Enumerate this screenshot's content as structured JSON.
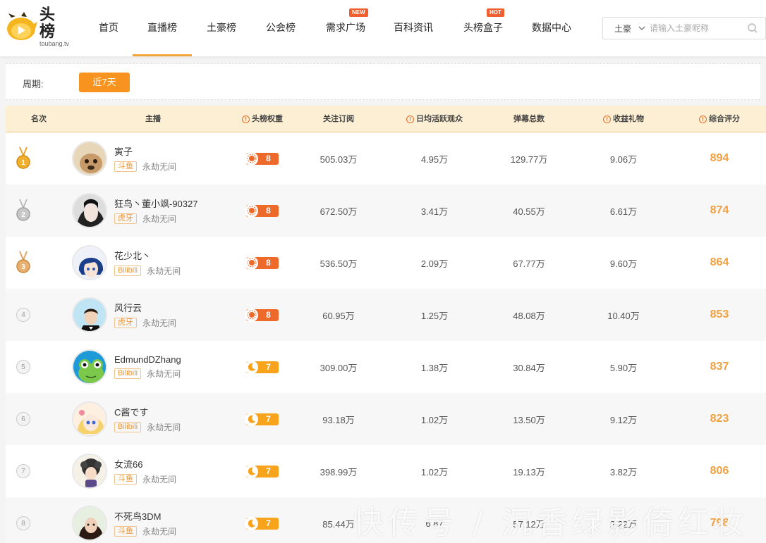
{
  "header": {
    "logo": {
      "title": "头榜",
      "subtitle": "toubang.tv"
    },
    "nav": [
      {
        "label": "首页",
        "active": false,
        "badge": ""
      },
      {
        "label": "直播榜",
        "active": true,
        "badge": ""
      },
      {
        "label": "土豪榜",
        "active": false,
        "badge": ""
      },
      {
        "label": "公会榜",
        "active": false,
        "badge": ""
      },
      {
        "label": "需求广场",
        "active": false,
        "badge": "NEW"
      },
      {
        "label": "百科资讯",
        "active": false,
        "badge": ""
      },
      {
        "label": "头榜盒子",
        "active": false,
        "badge": "HOT"
      },
      {
        "label": "数据中心",
        "active": false,
        "badge": ""
      }
    ],
    "search": {
      "selected": "土豪",
      "placeholder": "请输入土豪昵称"
    }
  },
  "filter": {
    "label": "周期:",
    "button": "近7天"
  },
  "table": {
    "headers": {
      "rank": "名次",
      "streamer": "主播",
      "weight": "头榜权重",
      "followers": "关注订阅",
      "daily_viewers": "日均活跃观众",
      "danmaku": "弹幕总数",
      "gifts": "收益礼物",
      "score": "综合评分"
    },
    "rows": [
      {
        "rank": "1",
        "name": "寅子",
        "platform": "斗鱼",
        "guild": "永劫无间",
        "weight": "8",
        "followers": "505.03万",
        "daily_viewers": "4.95万",
        "danmaku": "129.77万",
        "gifts": "9.06万",
        "score": "894"
      },
      {
        "rank": "2",
        "name": "狂鸟丶董小飒-90327",
        "platform": "虎牙",
        "guild": "永劫无间",
        "weight": "8",
        "followers": "672.50万",
        "daily_viewers": "3.41万",
        "danmaku": "40.55万",
        "gifts": "6.61万",
        "score": "874"
      },
      {
        "rank": "3",
        "name": "花少北丶",
        "platform": "Bilibili",
        "guild": "永劫无间",
        "weight": "8",
        "followers": "536.50万",
        "daily_viewers": "2.09万",
        "danmaku": "67.77万",
        "gifts": "9.60万",
        "score": "864"
      },
      {
        "rank": "4",
        "name": "风行云",
        "platform": "虎牙",
        "guild": "永劫无间",
        "weight": "8",
        "followers": "60.95万",
        "daily_viewers": "1.25万",
        "danmaku": "48.08万",
        "gifts": "10.40万",
        "score": "853"
      },
      {
        "rank": "5",
        "name": "EdmundDZhang",
        "platform": "Bilibili",
        "guild": "永劫无间",
        "weight": "7",
        "followers": "309.00万",
        "daily_viewers": "1.38万",
        "danmaku": "30.84万",
        "gifts": "5.90万",
        "score": "837"
      },
      {
        "rank": "6",
        "name": "C酱です",
        "platform": "Bilibili",
        "guild": "永劫无间",
        "weight": "7",
        "followers": "93.18万",
        "daily_viewers": "1.02万",
        "danmaku": "13.50万",
        "gifts": "9.12万",
        "score": "823"
      },
      {
        "rank": "7",
        "name": "女流66",
        "platform": "斗鱼",
        "guild": "永劫无间",
        "weight": "7",
        "followers": "398.99万",
        "daily_viewers": "1.02万",
        "danmaku": "19.13万",
        "gifts": "3.82万",
        "score": "806"
      },
      {
        "rank": "8",
        "name": "不死鸟3DM",
        "platform": "斗鱼",
        "guild": "永劫无间",
        "weight": "7",
        "followers": "85.44万",
        "daily_viewers": "6.87",
        "danmaku": "57.12万",
        "gifts": "2.22万",
        "score": "798"
      }
    ]
  },
  "watermark": "快传号 / 沉香绿影倚红妆",
  "colors": {
    "accent": "#f7931e",
    "score": "#f0a040",
    "header_bg": "#fdefd3",
    "gold": "#e8a020",
    "silver": "#b8b8b8",
    "bronze": "#e0a060"
  }
}
